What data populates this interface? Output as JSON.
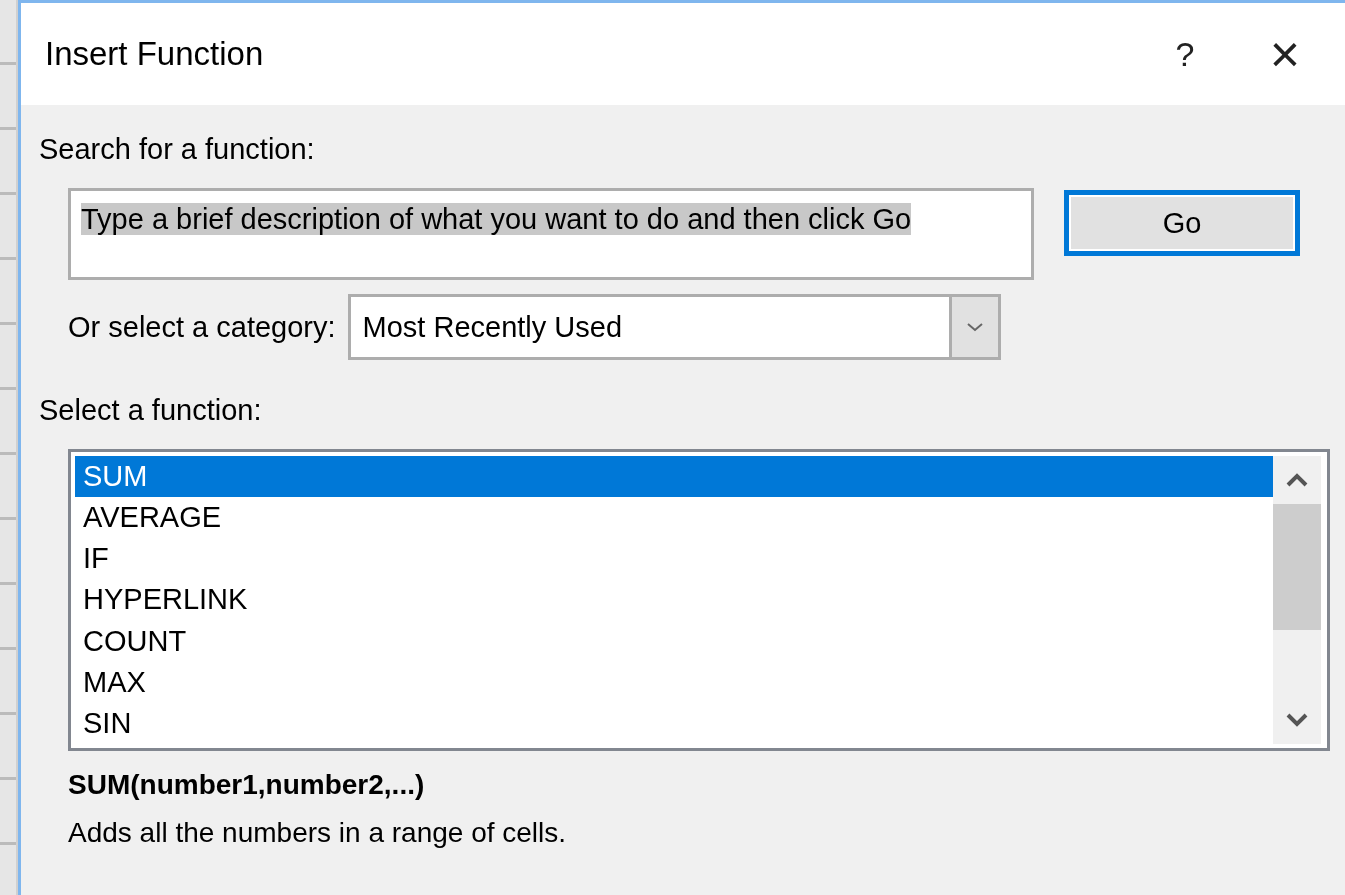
{
  "window": {
    "title": "Insert Function",
    "help": "?",
    "close": "×"
  },
  "search": {
    "label": "Search for a function:",
    "value": "Type a brief description of what you want to do and then click Go",
    "selected": true
  },
  "go_button": "Go",
  "category": {
    "label": "Or select a category:",
    "value": "Most Recently Used"
  },
  "function_list": {
    "label": "Select a function:",
    "items": [
      {
        "name": "SUM",
        "selected": true
      },
      {
        "name": "AVERAGE",
        "selected": false
      },
      {
        "name": "IF",
        "selected": false
      },
      {
        "name": "HYPERLINK",
        "selected": false
      },
      {
        "name": "COUNT",
        "selected": false
      },
      {
        "name": "MAX",
        "selected": false
      },
      {
        "name": "SIN",
        "selected": false
      }
    ]
  },
  "signature": "SUM(number1,number2,...)",
  "description": "Adds all the numbers in a range of cells."
}
